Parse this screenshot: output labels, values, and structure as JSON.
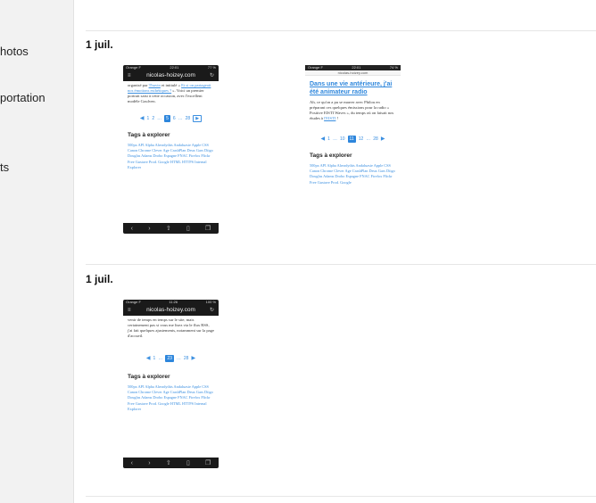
{
  "sidebar": {
    "items": [
      {
        "label": "hotos"
      },
      {
        "label": "portation"
      },
      {
        "label": "ts"
      }
    ]
  },
  "sections": [
    {
      "date": "1 juil."
    },
    {
      "date": "1 juil."
    }
  ],
  "shots": {
    "a": {
      "status_left": "Orange F",
      "status_time": "22:01",
      "status_right": "77 %",
      "url": "nicolas-hoizey.com",
      "text_pre": "organisé par ",
      "link1": "Thuvin",
      "text_mid": " et intitulé « ",
      "link2": "Et si on partageait nos émotions esthétiques ?",
      "text_post": " ». Voici un premier portrait saisi à cette occasion, avec l'excellent modèle Goulven.",
      "pager": [
        "1",
        "2",
        "…",
        "5",
        "6",
        "…",
        "28"
      ],
      "pager_current": "5",
      "tags_title": "Tags à explorer",
      "tags": "500px API Alpha Alreadythis Andaluzsie Apple CSS Canon Chrome Clever Age CrashPlan Deux Gars Diigo Douglas Adams Drobo Espagne FNAC Firefox Flickr Free Gustave Prod. Google HTML HTTPS Internal Explorer"
    },
    "b": {
      "status_left": "Orange F",
      "status_time": "22:01",
      "status_right": "74 %",
      "url": "nicolas-hoizey.com",
      "title": "Dans une vie antérieure, j'ai été animateur radio",
      "text": "Ah, ce qu'on a pu se marrer avec Philou en préparant ces quelques émissions pour la radio « Positive EISTI Waves », du temps où on faisait nos études à ",
      "link": "l'EISTI",
      "text_post": " !",
      "pager": [
        "1",
        "…",
        "10",
        "11",
        "12",
        "…",
        "28"
      ],
      "pager_current": "11",
      "tags_title": "Tags à explorer",
      "tags": "500px API Alpha Alreadythis Andaluzsie Apple CSS Canon Chrome Clever Age CrashPlan Deux Gars Diigo Douglas Adams Drobo Espagne FNAC Firefox Flickr Free Gustave Prod. Google"
    },
    "c": {
      "status_left": "Orange F",
      "status_time": "11:26",
      "status_right": "100 %",
      "url": "nicolas-hoizey.com",
      "text": "venir de temps en temps sur le site, mais certainement pas si vous me lisez via le flux RSS, j'ai fait quelques ajustements, notamment sur la page d'accueil.",
      "pager": [
        "1",
        "…",
        "23",
        "…",
        "28"
      ],
      "pager_current": "23",
      "tags_title": "Tags à explorer",
      "tags": "500px API Alpha Alreadythis Andaluzsie Apple CSS Canon Chrome Clever Age CrashPlan Deux Gars Diigo Douglas Adams Drobo Espagne FNAC Firefox Flickr Free Gustave Prod. Google HTML HTTPS Internal Explorer"
    }
  }
}
